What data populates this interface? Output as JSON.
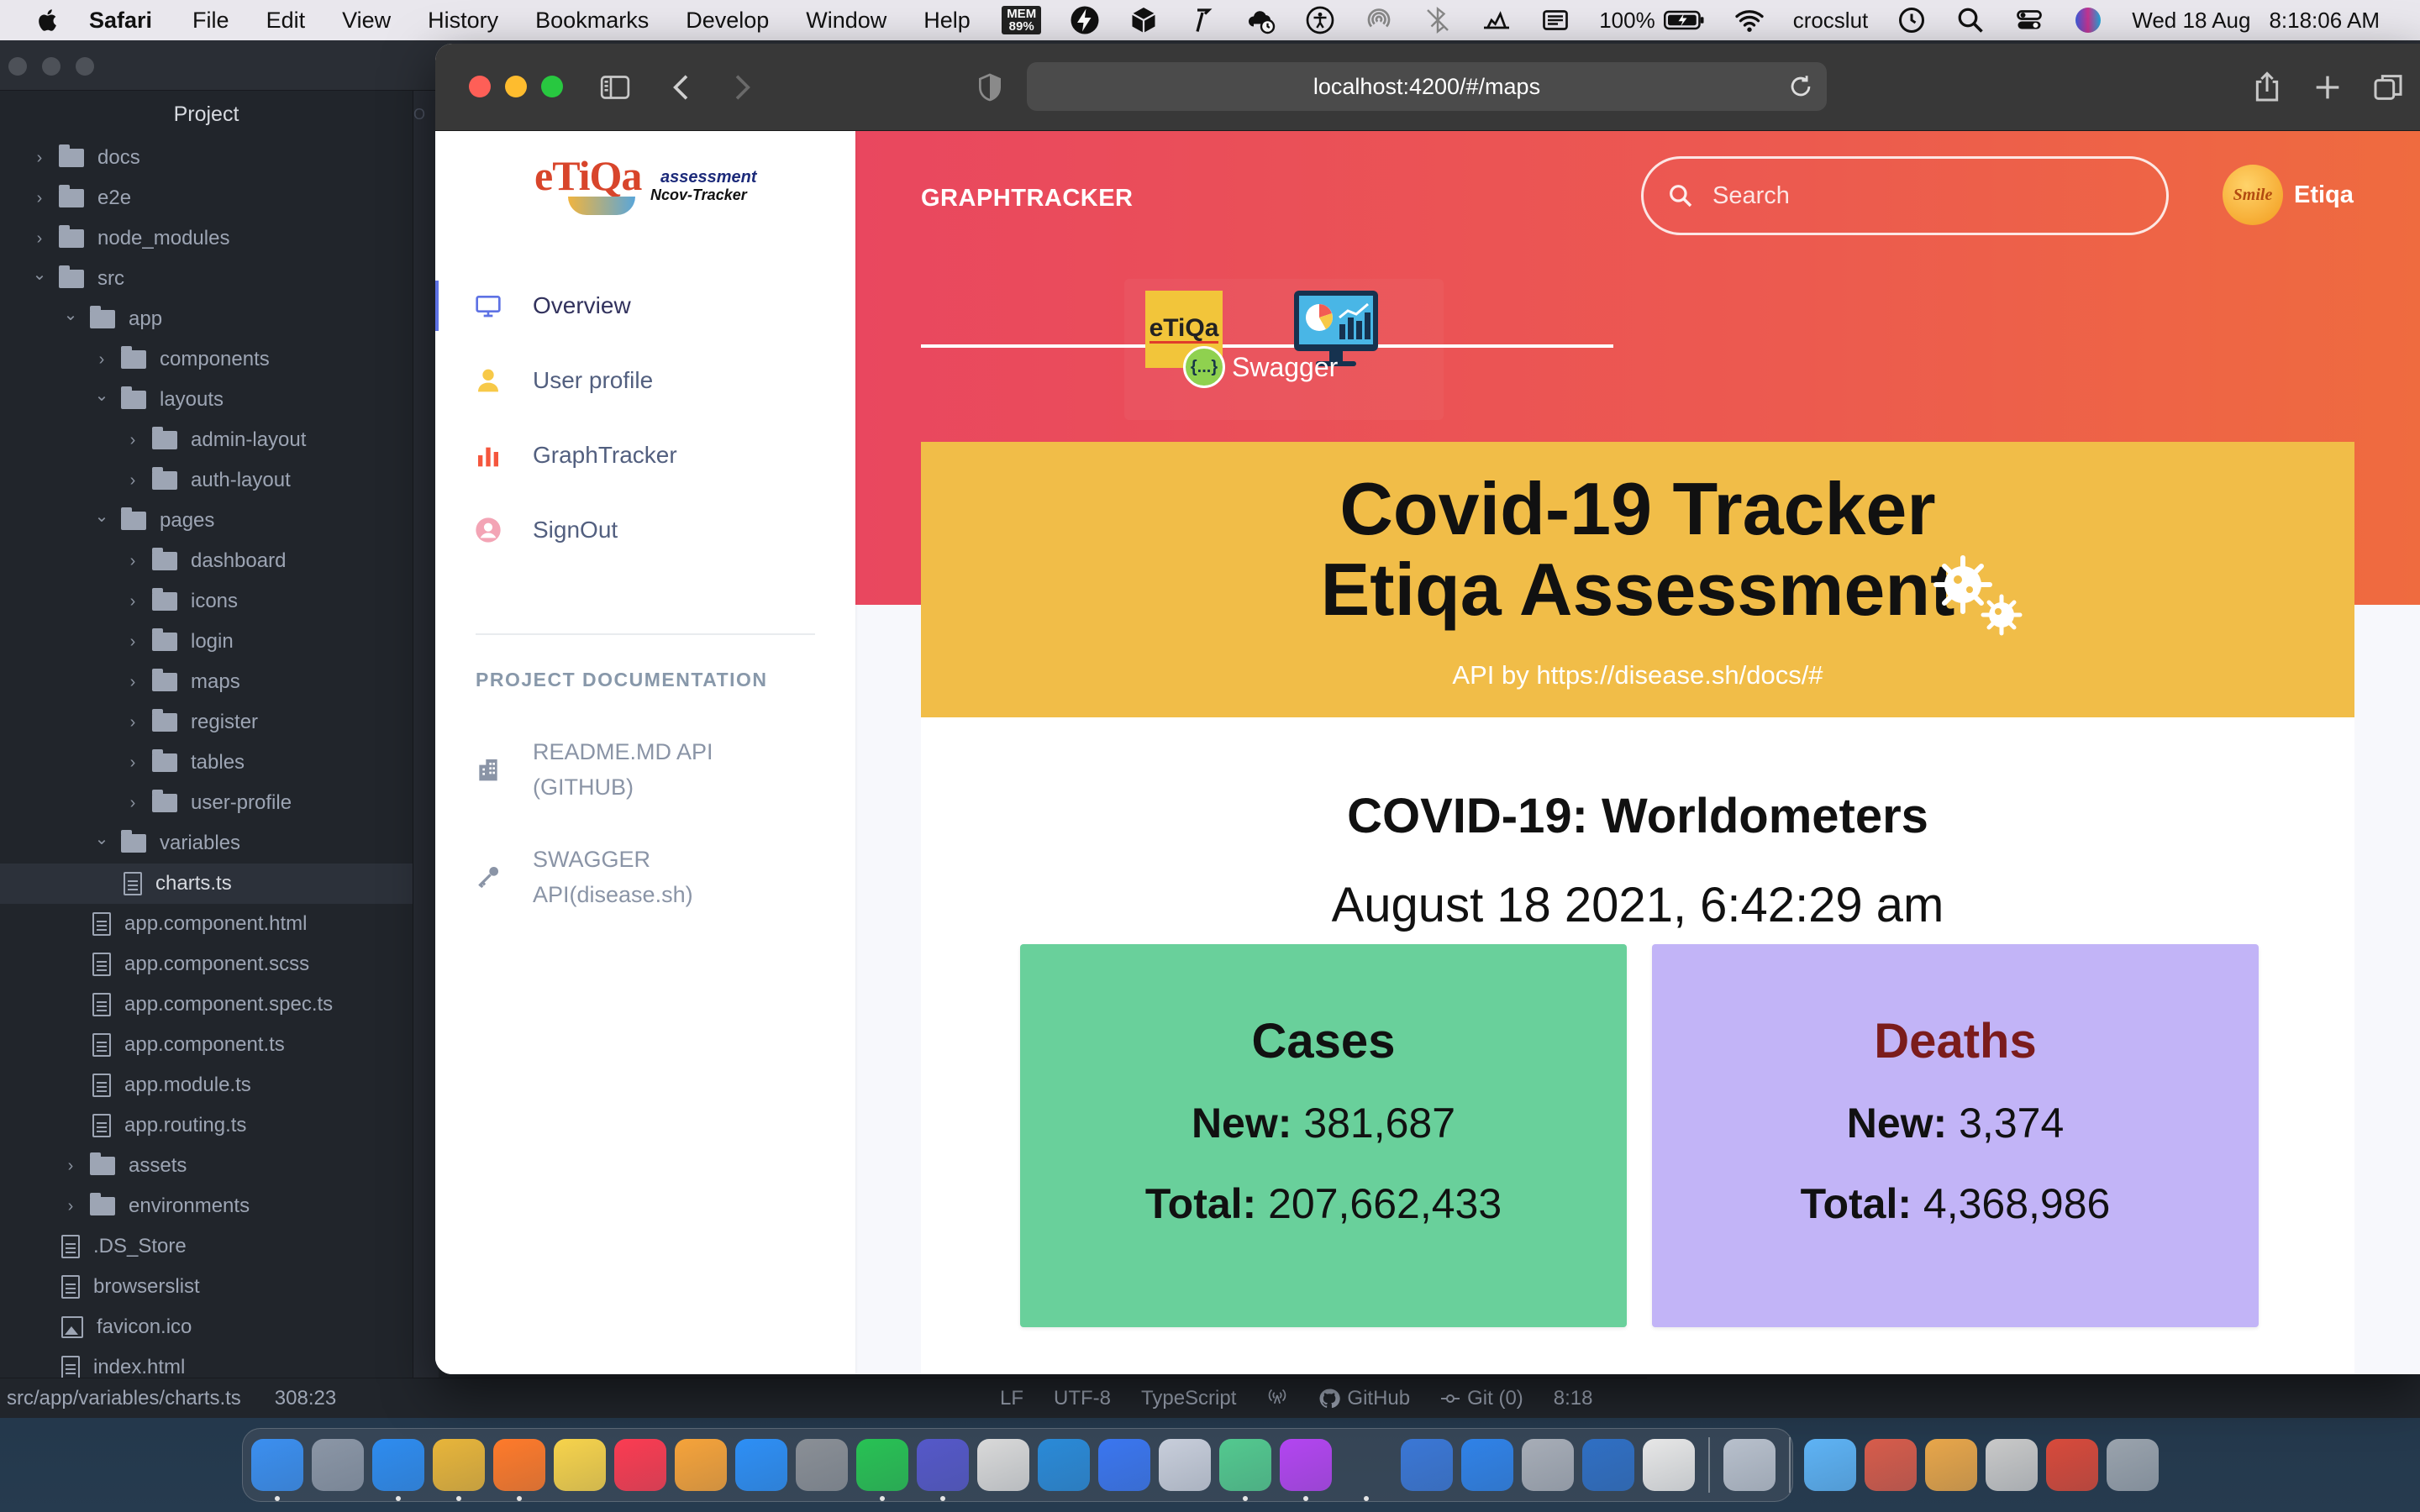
{
  "menubar": {
    "app_name": "Safari",
    "menus": [
      "File",
      "Edit",
      "View",
      "History",
      "Bookmarks",
      "Develop",
      "Window",
      "Help"
    ],
    "mem_label": "MEM",
    "mem_value": "89%",
    "battery": "100%",
    "username": "crocslut",
    "date": "Wed 18 Aug",
    "time": "8:18:06 AM"
  },
  "ide": {
    "tree_title": "Project",
    "strip_text": "O",
    "tree": [
      {
        "label": "docs",
        "type": "folder",
        "depth": 0,
        "state": "collapsed"
      },
      {
        "label": "e2e",
        "type": "folder",
        "depth": 0,
        "state": "collapsed"
      },
      {
        "label": "node_modules",
        "type": "folder",
        "depth": 0,
        "state": "collapsed"
      },
      {
        "label": "src",
        "type": "folder",
        "depth": 0,
        "state": "expanded"
      },
      {
        "label": "app",
        "type": "folder",
        "depth": 1,
        "state": "expanded"
      },
      {
        "label": "components",
        "type": "folder",
        "depth": 2,
        "state": "collapsed"
      },
      {
        "label": "layouts",
        "type": "folder",
        "depth": 2,
        "state": "expanded"
      },
      {
        "label": "admin-layout",
        "type": "folder",
        "depth": 3,
        "state": "collapsed"
      },
      {
        "label": "auth-layout",
        "type": "folder",
        "depth": 3,
        "state": "collapsed"
      },
      {
        "label": "pages",
        "type": "folder",
        "depth": 2,
        "state": "expanded"
      },
      {
        "label": "dashboard",
        "type": "folder",
        "depth": 3,
        "state": "collapsed"
      },
      {
        "label": "icons",
        "type": "folder",
        "depth": 3,
        "state": "collapsed"
      },
      {
        "label": "login",
        "type": "folder",
        "depth": 3,
        "state": "collapsed"
      },
      {
        "label": "maps",
        "type": "folder",
        "depth": 3,
        "state": "collapsed"
      },
      {
        "label": "register",
        "type": "folder",
        "depth": 3,
        "state": "collapsed"
      },
      {
        "label": "tables",
        "type": "folder",
        "depth": 3,
        "state": "collapsed"
      },
      {
        "label": "user-profile",
        "type": "folder",
        "depth": 3,
        "state": "collapsed"
      },
      {
        "label": "variables",
        "type": "folder",
        "depth": 2,
        "state": "expanded"
      },
      {
        "label": "charts.ts",
        "type": "file",
        "depth": 3,
        "selected": true
      },
      {
        "label": "app.component.html",
        "type": "file",
        "depth": 2
      },
      {
        "label": "app.component.scss",
        "type": "file",
        "depth": 2
      },
      {
        "label": "app.component.spec.ts",
        "type": "file",
        "depth": 2
      },
      {
        "label": "app.component.ts",
        "type": "file",
        "depth": 2
      },
      {
        "label": "app.module.ts",
        "type": "file",
        "depth": 2
      },
      {
        "label": "app.routing.ts",
        "type": "file",
        "depth": 2
      },
      {
        "label": "assets",
        "type": "folder",
        "depth": 1,
        "state": "collapsed"
      },
      {
        "label": "environments",
        "type": "folder",
        "depth": 1,
        "state": "collapsed"
      },
      {
        "label": ".DS_Store",
        "type": "file",
        "depth": 1
      },
      {
        "label": "browserslist",
        "type": "file",
        "depth": 1
      },
      {
        "label": "favicon.ico",
        "type": "image",
        "depth": 1
      },
      {
        "label": "index.html",
        "type": "file",
        "depth": 1
      }
    ],
    "status": {
      "path": "src/app/variables/charts.ts",
      "cursor": "308:23",
      "line_ending": "LF",
      "encoding": "UTF-8",
      "grammar": "TypeScript",
      "github": "GitHub",
      "git": "Git (0)",
      "clock": "8:18"
    }
  },
  "safari": {
    "url": "localhost:4200/#/maps"
  },
  "app": {
    "logo": {
      "word": "eTiQa",
      "sub": "assessment",
      "sub2": "Ncov-Tracker"
    },
    "nav": [
      {
        "label": "Overview",
        "icon": "monitor-icon",
        "active": true
      },
      {
        "label": "User profile",
        "icon": "user-icon",
        "active": false
      },
      {
        "label": "GraphTracker",
        "icon": "bar-chart-icon",
        "active": false
      },
      {
        "label": "SignOut",
        "icon": "user-circle-icon",
        "active": false
      }
    ],
    "doc_heading": "PROJECT DOCUMENTATION",
    "doc_links": [
      {
        "label_line1": "README.MD API",
        "label_line2": "(GITHUB)",
        "icon": "building-icon"
      },
      {
        "label_line1": "SWAGGER",
        "label_line2": "API(disease.sh)",
        "icon": "key-icon"
      }
    ],
    "header": {
      "brand": "GRAPHTRACKER",
      "search_placeholder": "Search",
      "avatar_text": "Smile",
      "user_name": "Etiqa"
    },
    "header_logos": {
      "etiqa": "eTiQa",
      "swagger_ball": "{...}",
      "swagger_word": "Swagger"
    },
    "banner": {
      "title_line1": "Covid-19 Tracker",
      "title_line2": "Etiqa Assessment",
      "api_credit": "API by https://disease.sh/docs/#"
    },
    "worldometers": {
      "title": "COVID-19: Worldometers",
      "date": "August 18 2021, 6:42:29 am"
    },
    "cards": {
      "cases": {
        "title": "Cases",
        "new_label": "New:",
        "new_value": "381,687",
        "total_label": "Total:",
        "total_value": "207,662,433"
      },
      "deaths": {
        "title": "Deaths",
        "new_label": "New:",
        "new_value": "3,374",
        "total_label": "Total:",
        "total_value": "4,368,986"
      }
    }
  },
  "dock": [
    {
      "name": "finder",
      "color": "#3b8ff0",
      "running": true
    },
    {
      "name": "launchpad",
      "color": "#8b96a6",
      "running": false
    },
    {
      "name": "safari",
      "color": "#2e8cf0",
      "running": true
    },
    {
      "name": "chrome",
      "color": "#e8b53a",
      "running": true
    },
    {
      "name": "firefox",
      "color": "#ff7a2a",
      "running": true
    },
    {
      "name": "notes",
      "color": "#f7d34b",
      "running": false
    },
    {
      "name": "music",
      "color": "#fb3c52",
      "running": false
    },
    {
      "name": "pages",
      "color": "#f6a33a",
      "running": false
    },
    {
      "name": "app-store",
      "color": "#2d8ff6",
      "running": false
    },
    {
      "name": "system-preferences",
      "color": "#8a8f96",
      "running": false
    },
    {
      "name": "whatsapp",
      "color": "#28c254",
      "running": true
    },
    {
      "name": "teams",
      "color": "#5558c9",
      "running": true
    },
    {
      "name": "tableplus",
      "color": "#d9d9d9",
      "running": false
    },
    {
      "name": "vscode",
      "color": "#2a8ad8",
      "running": false
    },
    {
      "name": "signal",
      "color": "#3a76f0",
      "running": false
    },
    {
      "name": "bbedit",
      "color": "#c8cedb",
      "running": false
    },
    {
      "name": "atom",
      "color": "#53c98f",
      "running": true
    },
    {
      "name": "phpstorm",
      "color": "#b345f1",
      "running": true
    },
    {
      "name": "terminal",
      "color": "#222",
      "running": true
    },
    {
      "name": "xcode",
      "color": "#3a77d6",
      "running": false
    },
    {
      "name": "simulator",
      "color": "#2f82e8",
      "running": false
    },
    {
      "name": "screens",
      "color": "#a7adb7",
      "running": false
    },
    {
      "name": "outlook-mobile",
      "color": "#2f6fc4",
      "running": false
    },
    {
      "name": "textedit",
      "color": "#e7e7e7",
      "running": false
    },
    {
      "name": "image-capture",
      "color": "#b8c0cc",
      "running": false
    },
    {
      "name": "downloads-folder",
      "color": "#5eb3f5",
      "running": false
    },
    {
      "name": "stack-1",
      "color": "#d75c4b",
      "running": false
    },
    {
      "name": "stack-2",
      "color": "#e8a64a",
      "running": false
    },
    {
      "name": "stack-3",
      "color": "#c9c9c9",
      "running": false
    },
    {
      "name": "stack-4",
      "color": "#d84a3b",
      "running": false
    },
    {
      "name": "trash",
      "color": "#9aa3ad",
      "running": false
    }
  ]
}
